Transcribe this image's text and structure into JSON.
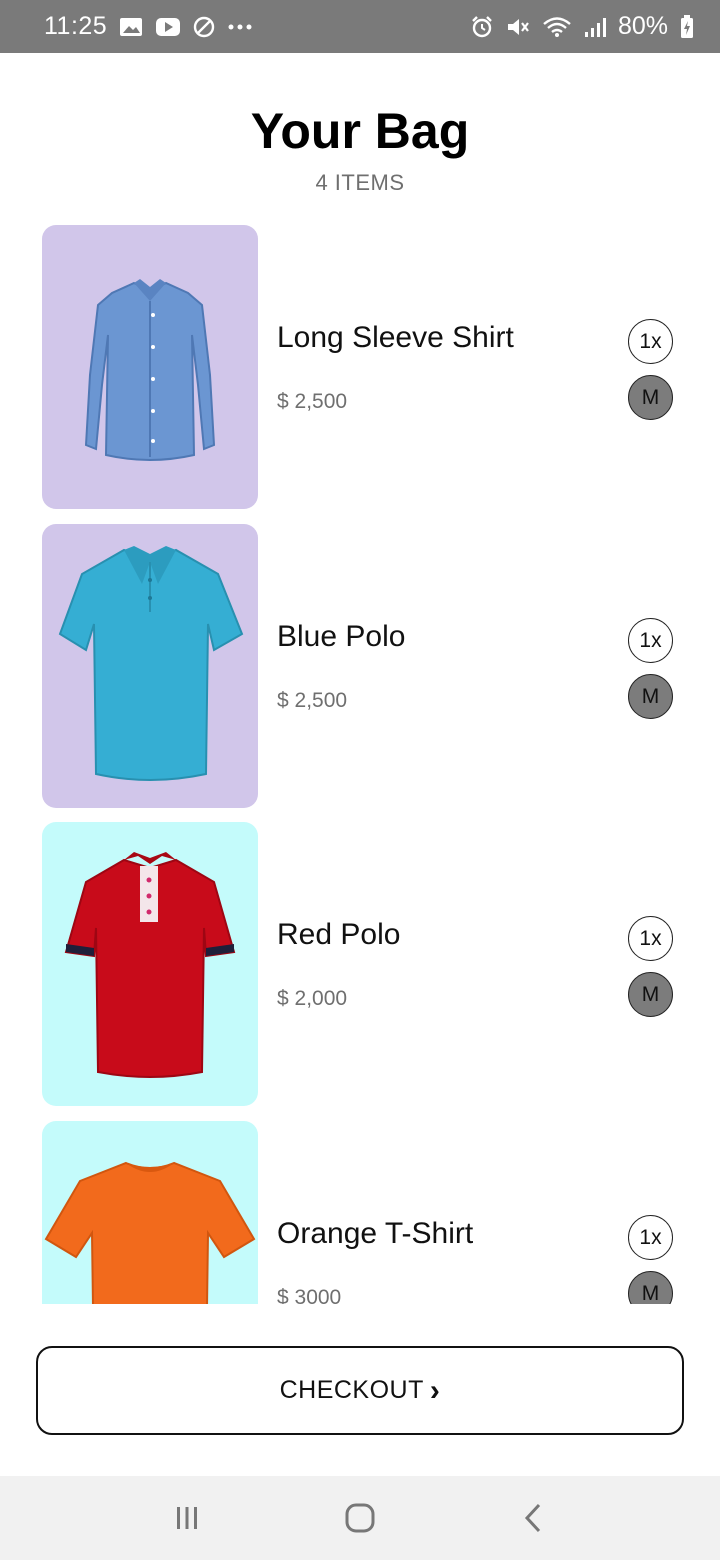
{
  "status_bar": {
    "time": "11:25",
    "battery": "80%",
    "left_icons": [
      "image-icon",
      "youtube-icon",
      "blocked-icon",
      "more-dots-icon"
    ],
    "right_icons": [
      "alarm-icon",
      "mute-icon",
      "wifi-icon",
      "signal-icon",
      "battery-icon"
    ]
  },
  "header": {
    "title": "Your Bag",
    "item_count": "4 ITEMS"
  },
  "items": [
    {
      "name": "Long Sleeve Shirt",
      "price": "$ 2,500",
      "quantity": "1x",
      "size": "M",
      "thumb_bg": "#d1c6ea",
      "garment_color": "#6b96d2",
      "garment_icon": "long-sleeve-shirt-icon"
    },
    {
      "name": "Blue Polo",
      "price": "$ 2,500",
      "quantity": "1x",
      "size": "M",
      "thumb_bg": "#d1c6ea",
      "garment_color": "#35aed3",
      "garment_icon": "polo-shirt-icon"
    },
    {
      "name": "Red Polo",
      "price": "$ 2,000",
      "quantity": "1x",
      "size": "M",
      "thumb_bg": "#c4fbfb",
      "garment_color": "#c80b1a",
      "garment_icon": "polo-shirt-icon"
    },
    {
      "name": "Orange T-Shirt",
      "price": "$ 3000",
      "quantity": "1x",
      "size": "M",
      "thumb_bg": "#c4fbfb",
      "garment_color": "#f26a1c",
      "garment_icon": "t-shirt-icon"
    }
  ],
  "checkout": {
    "label": "CHECKOUT",
    "chevron": "›"
  },
  "nav_bar": {
    "icons": [
      "recent-apps-icon",
      "home-icon",
      "back-icon"
    ]
  }
}
